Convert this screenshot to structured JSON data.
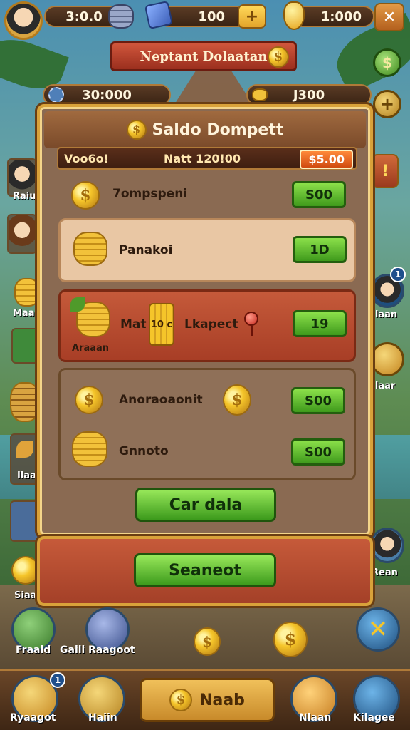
{
  "top_bar": {
    "resource_1": "3:0.0",
    "resource_2": "100",
    "resource_3": "1:000",
    "add_label": "+",
    "close_label": "✕"
  },
  "banner": {
    "title": "Neptant Dolaatan"
  },
  "secondary_bar": {
    "left_value": "30:000",
    "right_value": "J300"
  },
  "panel": {
    "title": "Saldo Dompett",
    "info_left": "Voo6o!",
    "info_center": "Natt 120!00",
    "info_right": "$5.00",
    "rows": [
      {
        "label": "7ompspeni",
        "button": "S00"
      },
      {
        "label": "Panakoi",
        "button": "1D"
      },
      {
        "label_left": "Mat",
        "label_card": "10 c",
        "label_right": "Lkapect",
        "caption": "Araaan",
        "button": "19"
      },
      {
        "label": "Anoraoaonit",
        "button": "S00"
      },
      {
        "label": "Gnnoto",
        "button": "S00"
      }
    ],
    "primary_button": "Car dala",
    "secondary_button": "Seaneot"
  },
  "left_side": [
    "Raiu",
    "Maao",
    "Ilaa",
    "Siaa"
  ],
  "right_side": [
    "Ilaan",
    "Ilaar",
    "Rean"
  ],
  "right_side_badge": "1",
  "lower_icons": {
    "left_1": "Fraaid",
    "left_2": "Gaili",
    "left_3": "Raagoot"
  },
  "bottom_nav": {
    "items": [
      "Ryaagot",
      "Haiin",
      "Nlaan",
      "Kilagee"
    ],
    "center_label": "Naab",
    "badge": "1"
  },
  "colors": {
    "gold": "#f5c52a",
    "green_button": "#5ab82a",
    "panel_brown": "#8a6a52",
    "highlight_red": "#b8482e"
  }
}
